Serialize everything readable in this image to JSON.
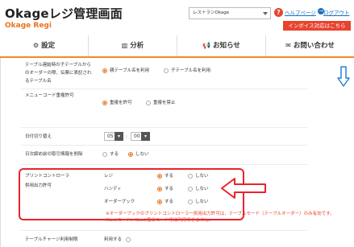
{
  "header": {
    "app_title": "Okageレジ管理画面",
    "app_subtitle": "Okage Regi",
    "store_select": "レストランOkage",
    "help_link": "ヘルプページ",
    "logout_link": "ログアウト",
    "invoice_button": "インボイス対応はこちら"
  },
  "nav": [
    {
      "label": "設定",
      "icon": "gear-icon"
    },
    {
      "label": "分析",
      "icon": "chart-icon"
    },
    {
      "label": "お知らせ",
      "icon": "megaphone-icon"
    },
    {
      "label": "お問い合わせ",
      "icon": "mail-icon"
    }
  ],
  "settings": {
    "row1": {
      "label_lines": [
        "テーブル連結時の子テーブルから",
        "のオーダーの際、伝票に表記され",
        "るテーブル名"
      ],
      "opt_on": "親テーブル名を利用",
      "opt_off": "子テーブル名を利用"
    },
    "row2": {
      "label": "メニューコード重複許可",
      "opt_on": "重複を許可",
      "opt_off": "重複を禁止"
    },
    "row3": {
      "label": "日付切り替え",
      "hour": "05",
      "minute": "00",
      "colon": ":"
    },
    "row4": {
      "label": "日次締め前の取引情報を削除",
      "opt_off": "する",
      "opt_on": "しない"
    },
    "row5": {
      "label_lines": [
        "プリントコントローラ",
        "併用出力許可"
      ],
      "items": [
        {
          "name": "レジ",
          "opt_on": "する",
          "opt_off": "しない"
        },
        {
          "name": "ハンディ",
          "opt_on": "する",
          "opt_off": "しない"
        },
        {
          "name": "オーダーブック",
          "opt_on": "する",
          "opt_off": "しない"
        }
      ],
      "note": "※オーダーブックのプリントコントローラー併用出力許可は、テーブルモード（テーブルオーダー）のみ有効です。Kioskモード、Kiosk複合モードでは利用できません。"
    },
    "row6": {
      "label": "テーブルチャージ利用制限",
      "opt": "利用する"
    }
  },
  "colors": {
    "accent": "#e8731c",
    "red": "#e8242e",
    "link": "#1a6fc1"
  }
}
